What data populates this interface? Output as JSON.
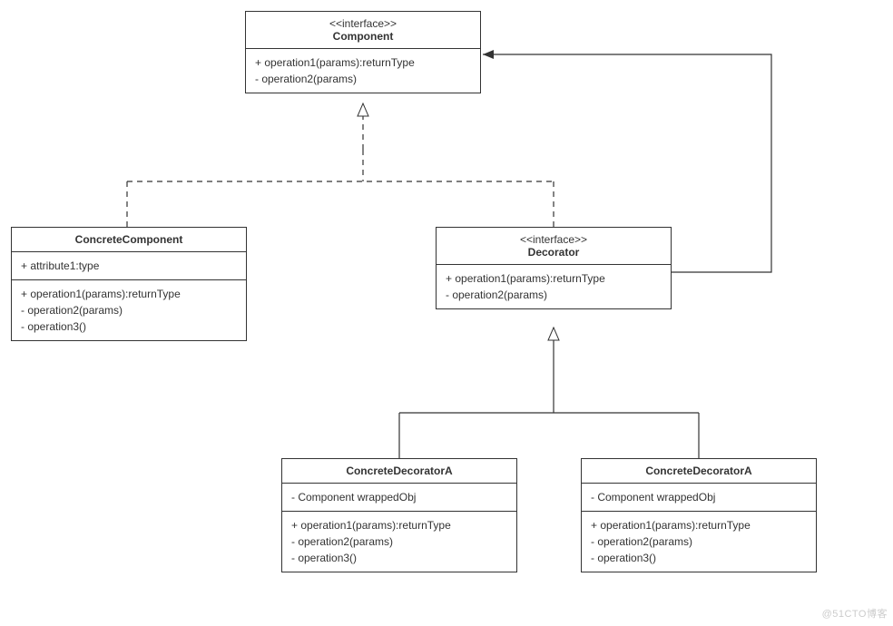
{
  "watermark": "@51CTO博客",
  "boxes": {
    "component": {
      "stereotype": "<<interface>>",
      "name": "Component",
      "attrs": [],
      "ops": [
        "+ operation1(params):returnType",
        "- operation2(params)"
      ]
    },
    "concreteComponent": {
      "stereotype": "",
      "name": "ConcreteComponent",
      "attrs": [
        "+ attribute1:type"
      ],
      "ops": [
        "+ operation1(params):returnType",
        "- operation2(params)",
        "- operation3()"
      ]
    },
    "decorator": {
      "stereotype": "<<interface>>",
      "name": "Decorator",
      "attrs": [],
      "ops": [
        "+ operation1(params):returnType",
        "- operation2(params)"
      ]
    },
    "concreteDecoratorA": {
      "stereotype": "",
      "name": "ConcreteDecoratorA",
      "attrs": [
        "- Component wrappedObj"
      ],
      "ops": [
        "+ operation1(params):returnType",
        "- operation2(params)",
        "- operation3()"
      ]
    },
    "concreteDecoratorB": {
      "stereotype": "",
      "name": "ConcreteDecoratorA",
      "attrs": [
        "- Component wrappedObj"
      ],
      "ops": [
        "+ operation1(params):returnType",
        "- operation2(params)",
        "- operation3()"
      ]
    }
  },
  "chart_data": {
    "type": "diagram",
    "diagram_type": "uml-class",
    "nodes": [
      {
        "id": "Component",
        "stereotype": "interface",
        "attributes": [],
        "operations": [
          "+ operation1(params):returnType",
          "- operation2(params)"
        ]
      },
      {
        "id": "ConcreteComponent",
        "attributes": [
          "+ attribute1:type"
        ],
        "operations": [
          "+ operation1(params):returnType",
          "- operation2(params)",
          "- operation3()"
        ]
      },
      {
        "id": "Decorator",
        "stereotype": "interface",
        "attributes": [],
        "operations": [
          "+ operation1(params):returnType",
          "- operation2(params)"
        ]
      },
      {
        "id": "ConcreteDecoratorA_1",
        "display": "ConcreteDecoratorA",
        "attributes": [
          "- Component wrappedObj"
        ],
        "operations": [
          "+ operation1(params):returnType",
          "- operation2(params)",
          "- operation3()"
        ]
      },
      {
        "id": "ConcreteDecoratorA_2",
        "display": "ConcreteDecoratorA",
        "attributes": [
          "- Component wrappedObj"
        ],
        "operations": [
          "+ operation1(params):returnType",
          "- operation2(params)",
          "- operation3()"
        ]
      }
    ],
    "edges": [
      {
        "from": "ConcreteComponent",
        "to": "Component",
        "type": "realization"
      },
      {
        "from": "Decorator",
        "to": "Component",
        "type": "realization"
      },
      {
        "from": "ConcreteDecoratorA_1",
        "to": "Decorator",
        "type": "generalization"
      },
      {
        "from": "ConcreteDecoratorA_2",
        "to": "Decorator",
        "type": "generalization"
      },
      {
        "from": "Decorator",
        "to": "Component",
        "type": "association"
      }
    ]
  }
}
